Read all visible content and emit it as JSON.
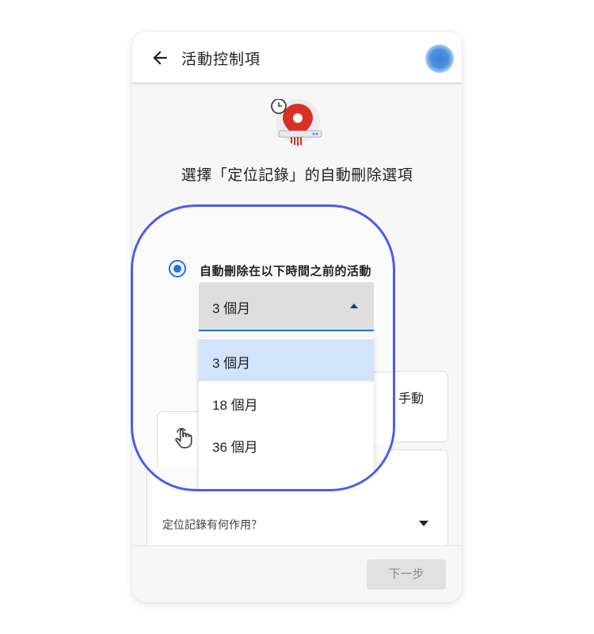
{
  "appbar": {
    "title": "活動控制項"
  },
  "heading": "選擇「定位記錄」的自動刪除選項",
  "options": {
    "auto_delete_label": "自動刪除在以下時間之前的活動",
    "selected_period": "3 個月",
    "dropdown_items": [
      "3 個月",
      "18 個月",
      "36 個月"
    ],
    "manual_label_fragment": "手動"
  },
  "info_card": {
    "question": "定位記錄有何作用？"
  },
  "footer": {
    "next_label": "下一步"
  },
  "colors": {
    "accent": "#1a73e8",
    "callout_border": "#4a5cf0",
    "selected_item_bg": "#d2e3fc",
    "pin_red": "#d93025"
  },
  "icons": {
    "back": "arrow-left-icon",
    "hero": "location-history-clock-icon",
    "hand": "hand-pointer-icon",
    "dropdown": "caret-down-icon"
  }
}
